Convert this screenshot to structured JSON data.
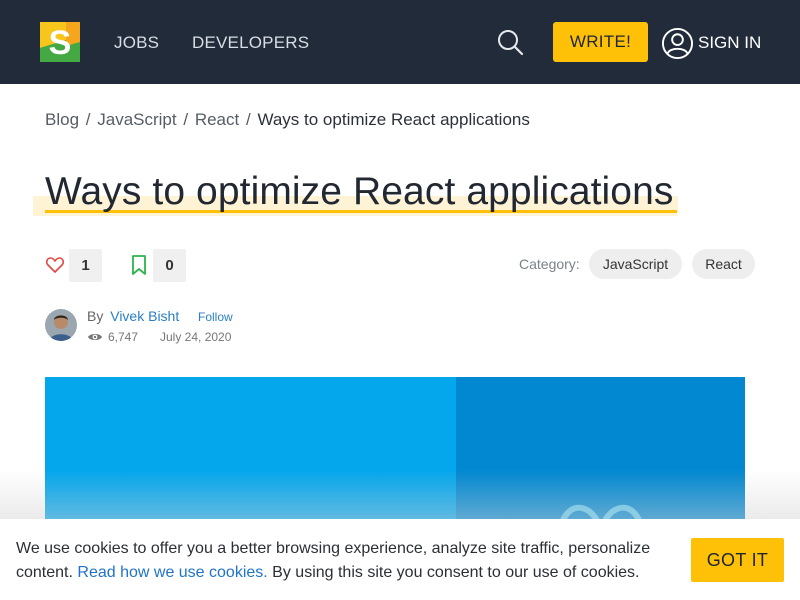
{
  "header": {
    "logo_icon": "sitepoint-s-logo",
    "nav": [
      {
        "label": "JOBS"
      },
      {
        "label": "DEVELOPERS"
      }
    ],
    "search_icon": "search-icon",
    "write_label": "WRITE!",
    "signin_label": "SIGN IN",
    "accent_color": "#ffc107",
    "bg_color": "#222b3a"
  },
  "breadcrumb": {
    "items": [
      "Blog",
      "JavaScript",
      "React"
    ],
    "current": "Ways to optimize React applications",
    "separator": "/"
  },
  "article": {
    "title": "Ways to optimize React applications",
    "likes": "1",
    "bookmarks": "0",
    "category_label": "Category:",
    "categories": [
      "JavaScript",
      "React"
    ],
    "author": {
      "by": "By",
      "name": "Vivek Bisht",
      "follow_label": "Follow",
      "views": "6,747",
      "date": "July 24, 2020"
    }
  },
  "hero": {
    "left_color": "#04a6ec",
    "right_color": "#0288d1"
  },
  "cookie_banner": {
    "text_before": "We use cookies to offer you a better browsing experience, analyze site traffic, personalize content.",
    "link_text": "Read how we use cookies.",
    "text_after": "By using this site you consent to our use of cookies.",
    "button_label": "GOT IT"
  }
}
